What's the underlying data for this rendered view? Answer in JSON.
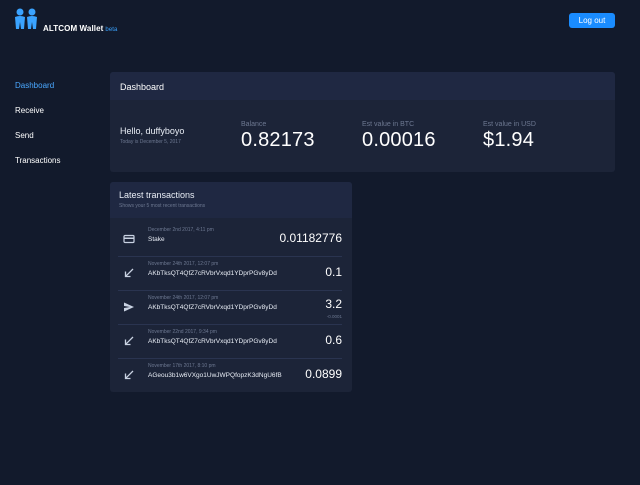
{
  "app": {
    "brand_name": "ALTCOM Wallet",
    "beta_label": "beta",
    "logout_label": "Log out",
    "accent_color": "#1a8cff"
  },
  "sidebar": {
    "items": [
      {
        "label": "Dashboard",
        "active": true
      },
      {
        "label": "Receive",
        "active": false
      },
      {
        "label": "Send",
        "active": false
      },
      {
        "label": "Transactions",
        "active": false
      }
    ]
  },
  "dashboard": {
    "title": "Dashboard",
    "greeting": "Hello, duffyboyo",
    "today": "Today is December 5, 2017",
    "stats": [
      {
        "label": "Balance",
        "value": "0.82173"
      },
      {
        "label": "Est value in BTC",
        "value": "0.00016"
      },
      {
        "label": "Est value in USD",
        "value": "$1.94"
      }
    ]
  },
  "transactions": {
    "title": "Latest transactions",
    "subtitle": "Shows your 5 most recent transactions",
    "rows": [
      {
        "icon": "stake-card-icon",
        "date": "December 2nd 2017, 4:11 pm",
        "desc": "Stake",
        "amount": "0.01182776",
        "fee": ""
      },
      {
        "icon": "receive-arrow-icon",
        "date": "November 24th 2017, 12:07 pm",
        "desc": "AKbTksQT4QfZ7cRVbrVxqd1YDprPGv8yDd",
        "amount": "0.1",
        "fee": ""
      },
      {
        "icon": "send-plane-icon",
        "date": "November 24th 2017, 12:07 pm",
        "desc": "AKbTksQT4QfZ7cRVbrVxqd1YDprPGv8yDd",
        "amount": "3.2",
        "fee": "-0.0001"
      },
      {
        "icon": "receive-arrow-icon",
        "date": "November 22nd 2017, 9:34 pm",
        "desc": "AKbTksQT4QfZ7cRVbrVxqd1YDprPGv8yDd",
        "amount": "0.6",
        "fee": ""
      },
      {
        "icon": "receive-arrow-icon",
        "date": "November 17th 2017, 8:10 pm",
        "desc": "AGeou3b1w6VXgo1UwJWPQfopzK3dNgU6fB",
        "amount": "0.0899",
        "fee": ""
      }
    ]
  }
}
